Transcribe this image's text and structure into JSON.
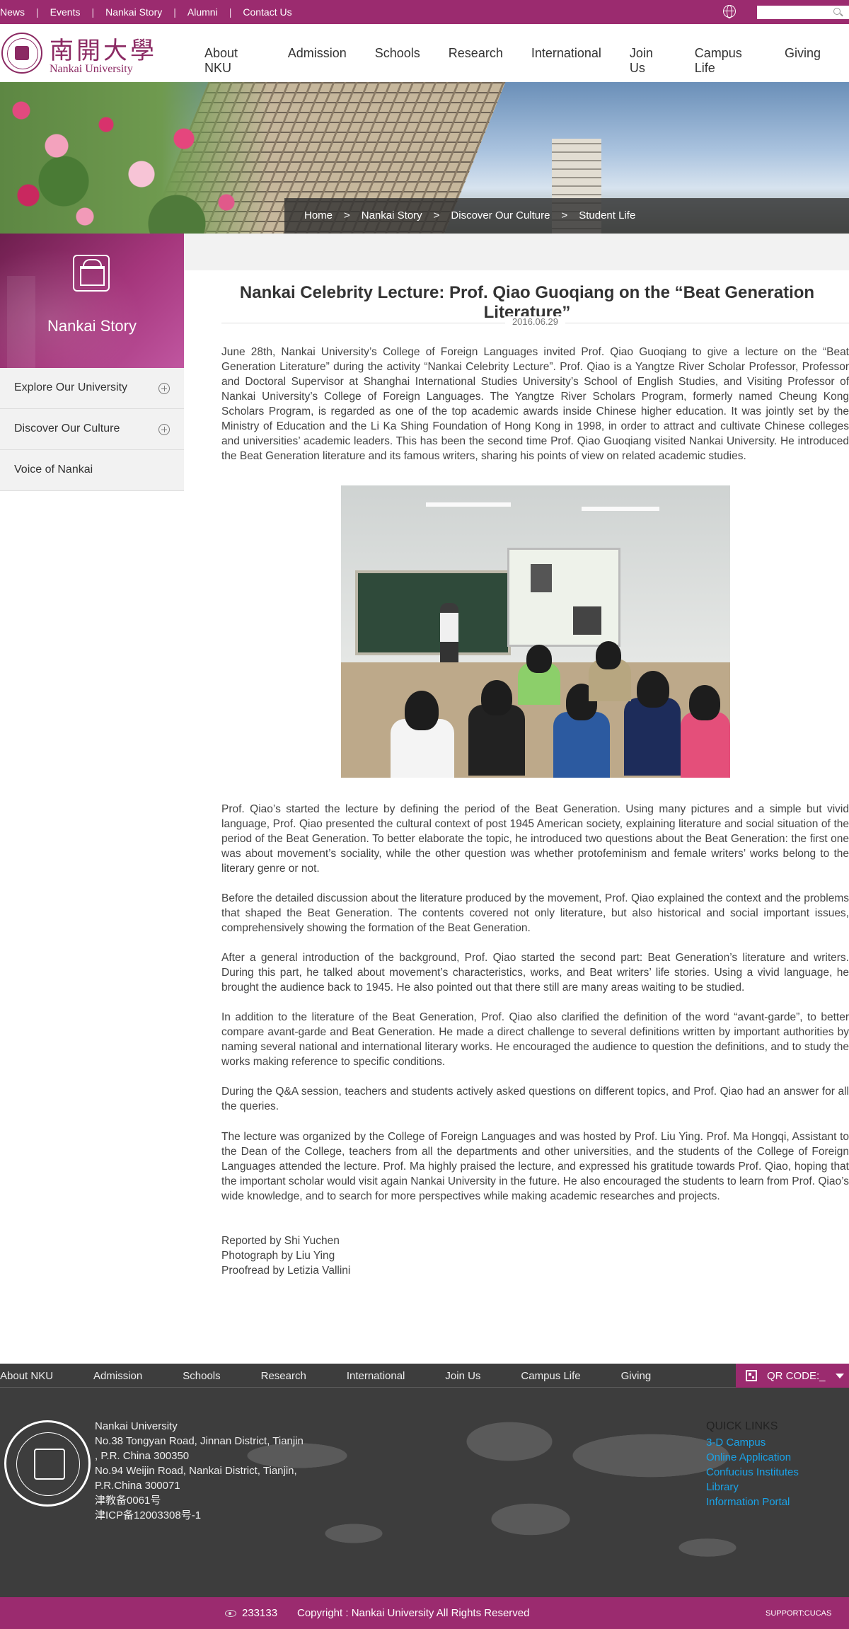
{
  "topbar": {
    "links": [
      "News",
      "Events",
      "Nankai Story",
      "Alumni",
      "Contact Us"
    ],
    "separator": "|",
    "search_placeholder": ""
  },
  "header": {
    "logo_cn": "南開大學",
    "logo_en": "Nankai University",
    "nav": [
      "About NKU",
      "Admission",
      "Schools",
      "Research",
      "International",
      "Join Us",
      "Campus Life",
      "Giving"
    ]
  },
  "breadcrumb": {
    "items": [
      "Home",
      "Nankai Story",
      "Discover Our Culture",
      "Student Life"
    ],
    "separator": ">"
  },
  "sidebar": {
    "title": "Nankai Story",
    "items": [
      {
        "label": "Explore Our University",
        "expandable": true
      },
      {
        "label": "Discover Our Culture",
        "expandable": true
      },
      {
        "label": "Voice of Nankai",
        "expandable": false
      }
    ]
  },
  "article": {
    "title": "Nankai Celebrity Lecture: Prof. Qiao Guoqiang on the “Beat Generation Literature”",
    "date": "2016.06.29",
    "intro": "June 28th, Nankai University’s College of Foreign Languages invited Prof. Qiao Guoqiang to give a lecture on the “Beat Generation Literature” during the activity “Nankai Celebrity Lecture”. Prof. Qiao is a Yangtze River Scholar Professor, Professor and Doctoral Supervisor at Shanghai International Studies University’s School of English Studies, and Visiting Professor of Nankai University’s College of Foreign Languages. The Yangtze River Scholars Program, formerly named Cheung Kong Scholars Program, is regarded as one of the top academic awards inside Chinese higher education. It was jointly set by the Ministry of Education and the Li Ka Shing Foundation of Hong Kong in 1998, in order to attract and cultivate Chinese colleges and universities’ academic leaders. This has been the second time Prof. Qiao Guoqiang visited Nankai University. He introduced the Beat Generation literature and its famous writers, sharing his points of view on related academic studies.",
    "paragraphs": [
      "Prof. Qiao’s started the lecture by defining the period of the Beat Generation. Using many pictures and a simple but vivid language, Prof. Qiao presented the cultural context of post 1945 American society, explaining literature and social situation of the period of the Beat Generation. To better elaborate the topic, he introduced two questions about the Beat Generation: the first one was about movement’s sociality, while the other question was whether protofeminism and female writers’ works belong to the literary genre or not.",
      "Before the detailed discussion about the literature produced by the movement, Prof. Qiao explained the context and the problems that shaped the Beat Generation. The contents covered not only literature, but also historical and social important issues, comprehensively showing the formation of the Beat Generation.",
      "After a general introduction of the background, Prof. Qiao started the second part: Beat Generation’s literature and writers. During this part, he talked about movement’s characteristics, works, and Beat writers’ life stories. Using a vivid language, he brought the audience back to 1945. He also pointed out that there still are many areas waiting to be studied.",
      "In addition to the literature of the Beat Generation, Prof. Qiao also clarified the definition of the word “avant-garde”, to better compare avant-garde and Beat Generation. He made a direct challenge to several definitions written by important authorities by naming several national and international literary works. He encouraged the audience to question the definitions, and to study the works making reference to specific conditions.",
      "During the Q&A session, teachers and students actively asked questions on different topics, and Prof. Qiao had an answer for all the queries.",
      "The lecture was organized by the College of Foreign Languages and was hosted by Prof. Liu Ying.  Prof. Ma Hongqi, Assistant to the Dean of the College, teachers from all the departments and other universities, and the students of the College of Foreign Languages attended the lecture. Prof. Ma highly praised the lecture, and expressed his gratitude towards Prof. Qiao, hoping that the important scholar would visit again Nankai University in the future. He also encouraged the students to learn from Prof. Qiao’s wide knowledge, and to search for more perspectives while making academic researches and projects."
    ],
    "credits": [
      "Reported by Shi Yuchen",
      "Photograph by Liu Ying",
      "Proofread by Letizia Vallini"
    ]
  },
  "footer": {
    "nav": [
      "About NKU",
      "Admission",
      "Schools",
      "Research",
      "International",
      "Join Us",
      "Campus Life",
      "Giving"
    ],
    "qr_label": "QR CODE:_",
    "address_lines": [
      "Nankai University",
      "No.38 Tongyan Road, Jinnan District, Tianjin",
      ", P.R. China 300350",
      "No.94 Weijin Road,  Nankai District, Tianjin,",
      "P.R.China  300071",
      "津教备0061号",
      "津ICP备12003308号-1"
    ],
    "quick_links_title": "QUICK LINKS",
    "quick_links": [
      "3-D Campus",
      "Online Application",
      "Confucius Institutes",
      "Library",
      "Information Portal"
    ],
    "visits": "233133",
    "copyright": "Copyright : Nankai University All Rights Reserved",
    "support": "SUPPORT:CUCAS"
  },
  "colors": {
    "brand": "#9b2b6f",
    "footer_bg": "#3d3d3d",
    "link": "#1aa3e8"
  }
}
